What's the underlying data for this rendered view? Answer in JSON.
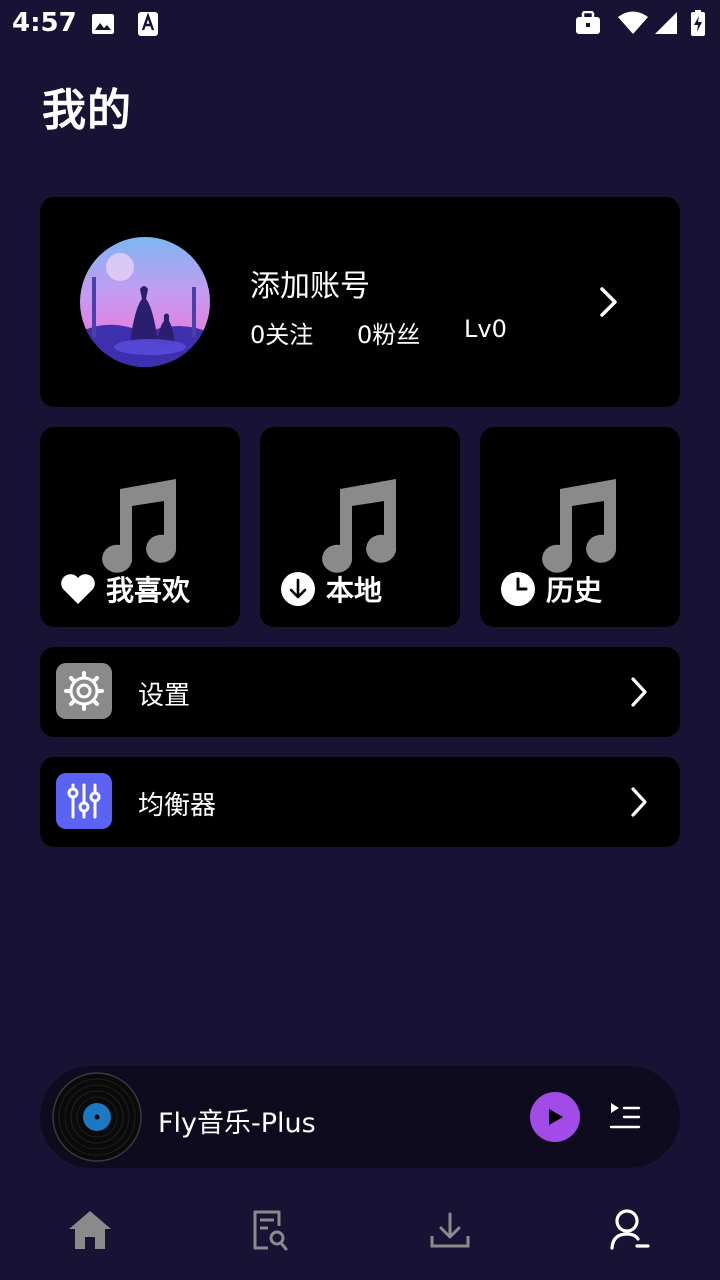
{
  "status_bar": {
    "time": "4:57",
    "icons": [
      "image-icon",
      "a-notification-icon",
      "briefcase-icon",
      "wifi-icon",
      "signal-icon",
      "battery-charging-icon"
    ]
  },
  "page": {
    "title": "我的"
  },
  "account": {
    "name": "添加账号",
    "following": "0关注",
    "followers": "0粉丝",
    "level": "Lv0"
  },
  "tiles": [
    {
      "label": "我喜欢",
      "icon": "heart-icon"
    },
    {
      "label": "本地",
      "icon": "download-circle-icon"
    },
    {
      "label": "历史",
      "icon": "clock-icon"
    }
  ],
  "rows": [
    {
      "label": "设置",
      "icon": "gear-icon",
      "icon_bg": "#8a8a8a"
    },
    {
      "label": "均衡器",
      "icon": "equalizer-icon",
      "icon_bg": "#5b63f5"
    }
  ],
  "player": {
    "title": "Fly音乐-Plus",
    "accent": "#a24ce8"
  },
  "bottom_nav": [
    {
      "name": "home",
      "icon": "home-icon"
    },
    {
      "name": "search",
      "icon": "search-doc-icon"
    },
    {
      "name": "download",
      "icon": "download-icon"
    },
    {
      "name": "profile",
      "icon": "user-icon",
      "active": true
    }
  ]
}
